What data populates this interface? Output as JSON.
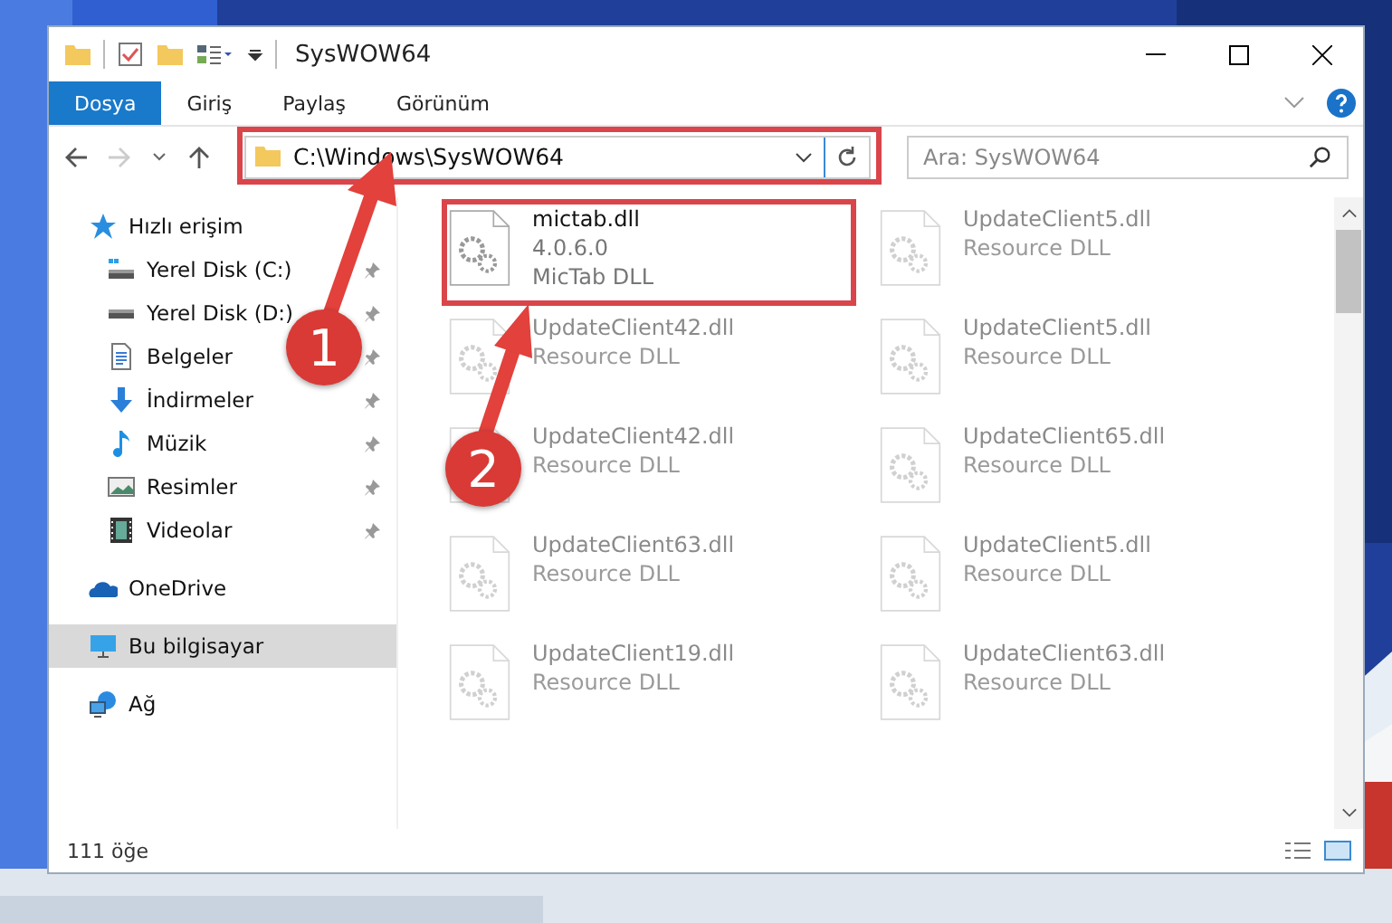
{
  "window": {
    "title": "SysWOW64"
  },
  "ribbon_tabs": [
    {
      "label": "Dosya",
      "selected": true
    },
    {
      "label": "Giriş",
      "selected": false
    },
    {
      "label": "Paylaş",
      "selected": false
    },
    {
      "label": "Görünüm",
      "selected": false
    }
  ],
  "address_bar": {
    "path": "C:\\Windows\\SysWOW64"
  },
  "search": {
    "placeholder": "Ara: SysWOW64"
  },
  "sidebar": {
    "items": [
      {
        "label": "Hızlı erişim",
        "kind": "star",
        "selected": false,
        "children": [
          {
            "label": "Yerel Disk (C:)",
            "kind": "drive-c",
            "pinned": true,
            "selected": false
          },
          {
            "label": "Yerel Disk (D:)",
            "kind": "drive",
            "pinned": true,
            "selected": false
          },
          {
            "label": "Belgeler",
            "kind": "document",
            "pinned": true,
            "selected": false
          },
          {
            "label": "İndirmeler",
            "kind": "download",
            "pinned": true,
            "selected": false
          },
          {
            "label": "Müzik",
            "kind": "music",
            "pinned": true,
            "selected": false
          },
          {
            "label": "Resimler",
            "kind": "pictures",
            "pinned": true,
            "selected": false
          },
          {
            "label": "Videolar",
            "kind": "video",
            "pinned": true,
            "selected": false
          }
        ]
      },
      {
        "label": "OneDrive",
        "kind": "cloud",
        "selected": false
      },
      {
        "label": "Bu bilgisayar",
        "kind": "computer",
        "selected": true
      },
      {
        "label": "Ağ",
        "kind": "network",
        "selected": false
      }
    ]
  },
  "files": [
    {
      "name": "mictab.dll",
      "details": [
        "4.0.6.0",
        "MicTab DLL"
      ],
      "faded": false
    },
    {
      "name": "UpdateClient5.dll",
      "details": [
        "Resource DLL"
      ],
      "faded": true
    },
    {
      "name": "UpdateClient42.dll",
      "details": [
        "Resource DLL"
      ],
      "faded": true
    },
    {
      "name": "UpdateClient5.dll",
      "details": [
        "Resource DLL"
      ],
      "faded": true
    },
    {
      "name": "UpdateClient42.dll",
      "details": [
        "Resource DLL"
      ],
      "faded": true
    },
    {
      "name": "UpdateClient65.dll",
      "details": [
        "Resource DLL"
      ],
      "faded": true
    },
    {
      "name": "UpdateClient63.dll",
      "details": [
        "Resource DLL"
      ],
      "faded": true
    },
    {
      "name": "UpdateClient5.dll",
      "details": [
        "Resource DLL"
      ],
      "faded": true
    },
    {
      "name": "UpdateClient19.dll",
      "details": [
        "Resource DLL"
      ],
      "faded": true
    },
    {
      "name": "UpdateClient63.dll",
      "details": [
        "Resource DLL"
      ],
      "faded": true
    }
  ],
  "status_bar": {
    "count": "111 öğe"
  },
  "annotations": [
    {
      "label": "1"
    },
    {
      "label": "2"
    }
  ]
}
